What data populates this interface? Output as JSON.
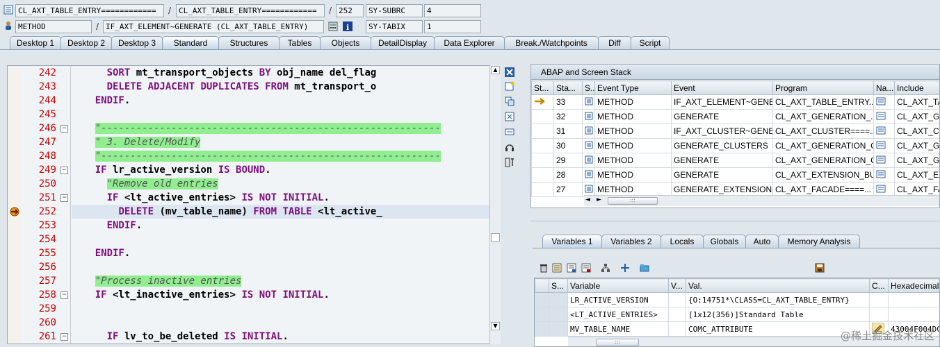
{
  "header": {
    "row1": {
      "field1": "CL_AXT_TABLE_ENTRY============",
      "field2": "CL_AXT_TABLE_ENTRY============",
      "line": "252",
      "sysvar": "SY-SUBRC",
      "sysval": "4"
    },
    "row2": {
      "type": "METHOD",
      "name": "IF_AXT_ELEMENT~GENERATE (CL_AXT_TABLE_ENTRY)",
      "sysvar": "SY-TABIX",
      "sysval": "1"
    },
    "sep": "/"
  },
  "tabs": [
    "Desktop 1",
    "Desktop 2",
    "Desktop 3",
    "Standard",
    "Structures",
    "Tables",
    "Objects",
    "DetailDisplay",
    "Data Explorer",
    "Break./Watchpoints",
    "Diff",
    "Script"
  ],
  "active_tab": "Standard",
  "code": {
    "lines": [
      {
        "n": "242",
        "fold": false,
        "segs": [
          {
            "t": "      ",
            "c": ""
          },
          {
            "t": "SORT",
            "c": "kw"
          },
          {
            "t": " mt_transport_objects ",
            "c": ""
          },
          {
            "t": "BY",
            "c": "kw"
          },
          {
            "t": " obj_name del_flag",
            "c": ""
          }
        ]
      },
      {
        "n": "243",
        "fold": false,
        "segs": [
          {
            "t": "      ",
            "c": ""
          },
          {
            "t": "DELETE ADJACENT DUPLICATES FROM",
            "c": "kw"
          },
          {
            "t": " mt_transport_o",
            "c": ""
          }
        ]
      },
      {
        "n": "244",
        "fold": false,
        "segs": [
          {
            "t": "    ",
            "c": ""
          },
          {
            "t": "ENDIF",
            "c": "kw"
          },
          {
            "t": ".",
            "c": ""
          }
        ]
      },
      {
        "n": "245",
        "fold": false,
        "segs": []
      },
      {
        "n": "246",
        "fold": true,
        "segs": [
          {
            "t": "    ",
            "c": ""
          },
          {
            "t": "\"----------------------------------------------------------",
            "c": "cm hl"
          }
        ]
      },
      {
        "n": "247",
        "fold": false,
        "segs": [
          {
            "t": "    ",
            "c": ""
          },
          {
            "t": "\" 3. Delete/Modify",
            "c": "cm hl"
          }
        ]
      },
      {
        "n": "248",
        "fold": false,
        "segs": [
          {
            "t": "    ",
            "c": ""
          },
          {
            "t": "\"----------------------------------------------------------",
            "c": "cm hl"
          }
        ]
      },
      {
        "n": "249",
        "fold": true,
        "segs": [
          {
            "t": "    ",
            "c": ""
          },
          {
            "t": "IF",
            "c": "kw"
          },
          {
            "t": " lr_active_version ",
            "c": ""
          },
          {
            "t": "IS BOUND",
            "c": "kw"
          },
          {
            "t": ".",
            "c": ""
          }
        ]
      },
      {
        "n": "250",
        "fold": false,
        "segs": [
          {
            "t": "      ",
            "c": ""
          },
          {
            "t": "\"Remove old entries",
            "c": "cm hl"
          }
        ]
      },
      {
        "n": "251",
        "fold": true,
        "segs": [
          {
            "t": "      ",
            "c": ""
          },
          {
            "t": "IF",
            "c": "kw"
          },
          {
            "t": " <lt_active_entries> ",
            "c": ""
          },
          {
            "t": "IS NOT INITIAL",
            "c": "kw"
          },
          {
            "t": ".",
            "c": ""
          }
        ]
      },
      {
        "n": "252",
        "fold": false,
        "segs": [
          {
            "t": "        ",
            "c": ""
          },
          {
            "t": "DELETE",
            "c": "kw"
          },
          {
            "t": " (mv_table_name) ",
            "c": ""
          },
          {
            "t": "FROM TABLE",
            "c": "kw"
          },
          {
            "t": " <lt_active_",
            "c": ""
          }
        ]
      },
      {
        "n": "253",
        "fold": false,
        "segs": [
          {
            "t": "      ",
            "c": ""
          },
          {
            "t": "ENDIF",
            "c": "kw"
          },
          {
            "t": ".",
            "c": ""
          }
        ]
      },
      {
        "n": "254",
        "fold": false,
        "segs": []
      },
      {
        "n": "255",
        "fold": false,
        "segs": [
          {
            "t": "    ",
            "c": ""
          },
          {
            "t": "ENDIF",
            "c": "kw"
          },
          {
            "t": ".",
            "c": ""
          }
        ]
      },
      {
        "n": "256",
        "fold": false,
        "segs": []
      },
      {
        "n": "257",
        "fold": false,
        "segs": [
          {
            "t": "    ",
            "c": ""
          },
          {
            "t": "\"Process inactive entries",
            "c": "cm hl"
          }
        ]
      },
      {
        "n": "258",
        "fold": true,
        "segs": [
          {
            "t": "    ",
            "c": ""
          },
          {
            "t": "IF",
            "c": "kw"
          },
          {
            "t": " <lt_inactive_entries> ",
            "c": ""
          },
          {
            "t": "IS NOT INITIAL",
            "c": "kw"
          },
          {
            "t": ".",
            "c": ""
          }
        ]
      },
      {
        "n": "259",
        "fold": false,
        "segs": []
      },
      {
        "n": "260",
        "fold": false,
        "segs": []
      },
      {
        "n": "261",
        "fold": true,
        "segs": [
          {
            "t": "      ",
            "c": ""
          },
          {
            "t": "IF",
            "c": "kw"
          },
          {
            "t": " lv_to_be_deleted ",
            "c": ""
          },
          {
            "t": "IS INITIAL",
            "c": "kw"
          },
          {
            "t": ".",
            "c": ""
          }
        ]
      }
    ],
    "current_line": "252"
  },
  "stack": {
    "title": "ABAP and Screen Stack",
    "headers": [
      "St...",
      "Sta...",
      "S...",
      "Event Type",
      "Event",
      "Program",
      "Na...",
      "Include"
    ],
    "rows": [
      {
        "level": "33",
        "type": "METHOD",
        "event": "IF_AXT_ELEMENT~GENE...",
        "program": "CL_AXT_TABLE_ENTRY...",
        "include": "CL_AXT_TA",
        "current": true
      },
      {
        "level": "32",
        "type": "METHOD",
        "event": "GENERATE",
        "program": "CL_AXT_GENERATION_...",
        "include": "CL_AXT_GE",
        "current": false
      },
      {
        "level": "31",
        "type": "METHOD",
        "event": "IF_AXT_CLUSTER~GENE...",
        "program": "CL_AXT_CLUSTER====...",
        "include": "CL_AXT_CL",
        "current": false
      },
      {
        "level": "30",
        "type": "METHOD",
        "event": "GENERATE_CLUSTERS",
        "program": "CL_AXT_GENERATION_C...",
        "include": "CL_AXT_GE",
        "current": false
      },
      {
        "level": "29",
        "type": "METHOD",
        "event": "GENERATE",
        "program": "CL_AXT_GENERATION_C...",
        "include": "CL_AXT_GE",
        "current": false
      },
      {
        "level": "28",
        "type": "METHOD",
        "event": "GENERATE",
        "program": "CL_AXT_EXTENSION_BU...",
        "include": "CL_AXT_EX",
        "current": false
      },
      {
        "level": "27",
        "type": "METHOD",
        "event": "GENERATE_EXTENSIONS",
        "program": "CL_AXT_FACADE====...",
        "include": "CL_AXT_FA",
        "current": false
      }
    ]
  },
  "var_tabs": [
    "Variables 1",
    "Variables 2",
    "Locals",
    "Globals",
    "Auto",
    "Memory Analysis"
  ],
  "active_var_tab": "Variables 1",
  "variables": {
    "headers": [
      "S...",
      "Variable",
      "V...",
      "Val.",
      "C...",
      "Hexadecimal V"
    ],
    "rows": [
      {
        "name": "LR_ACTIVE_VERSION",
        "value": "{O:14751*\\CLASS=CL_AXT_TABLE_ENTRY}",
        "hex": ""
      },
      {
        "name": "<LT_ACTIVE_ENTRIES>",
        "value": "[1x12(356)]Standard Table",
        "hex": ""
      },
      {
        "name": "MV_TABLE_NAME",
        "value": "COMC_ATTRIBUTE",
        "hex": "43004F004DC"
      }
    ]
  },
  "thumb_glyph": ":::",
  "watermark": "@稀土掘金技术社区"
}
